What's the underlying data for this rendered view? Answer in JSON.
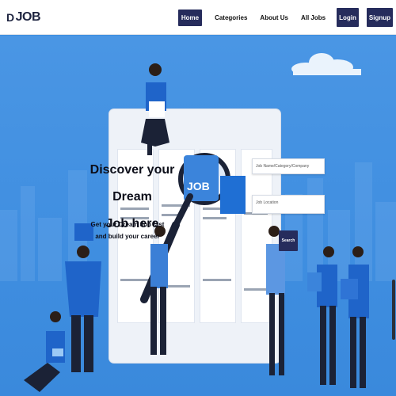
{
  "brand": {
    "mark": "D",
    "text": "JOB"
  },
  "nav": {
    "home": "Home",
    "categories": "Categories",
    "about": "About Us",
    "all_jobs": "All Jobs",
    "login": "Login",
    "signup": "Signup"
  },
  "hero": {
    "headline_line1": "Discover your Dream",
    "headline_line2": "Job here",
    "sub_line1": "Get your Dream Job fast",
    "sub_line2": "and build your career",
    "magnifier_text": "JOB"
  },
  "search": {
    "keyword_placeholder": "Job Name/Category/Company",
    "location_placeholder": "Job Location",
    "button_label": "Search"
  },
  "colors": {
    "background": "#3d8fe0",
    "navbar": "#ffffff",
    "primary_dark": "#262c5c",
    "text_dark": "#0d0f1a",
    "person_blue": "#1f64c9",
    "person_dark": "#1b2236"
  },
  "icons": [
    "magnifier-icon",
    "cloud-icon",
    "person-illustration"
  ]
}
